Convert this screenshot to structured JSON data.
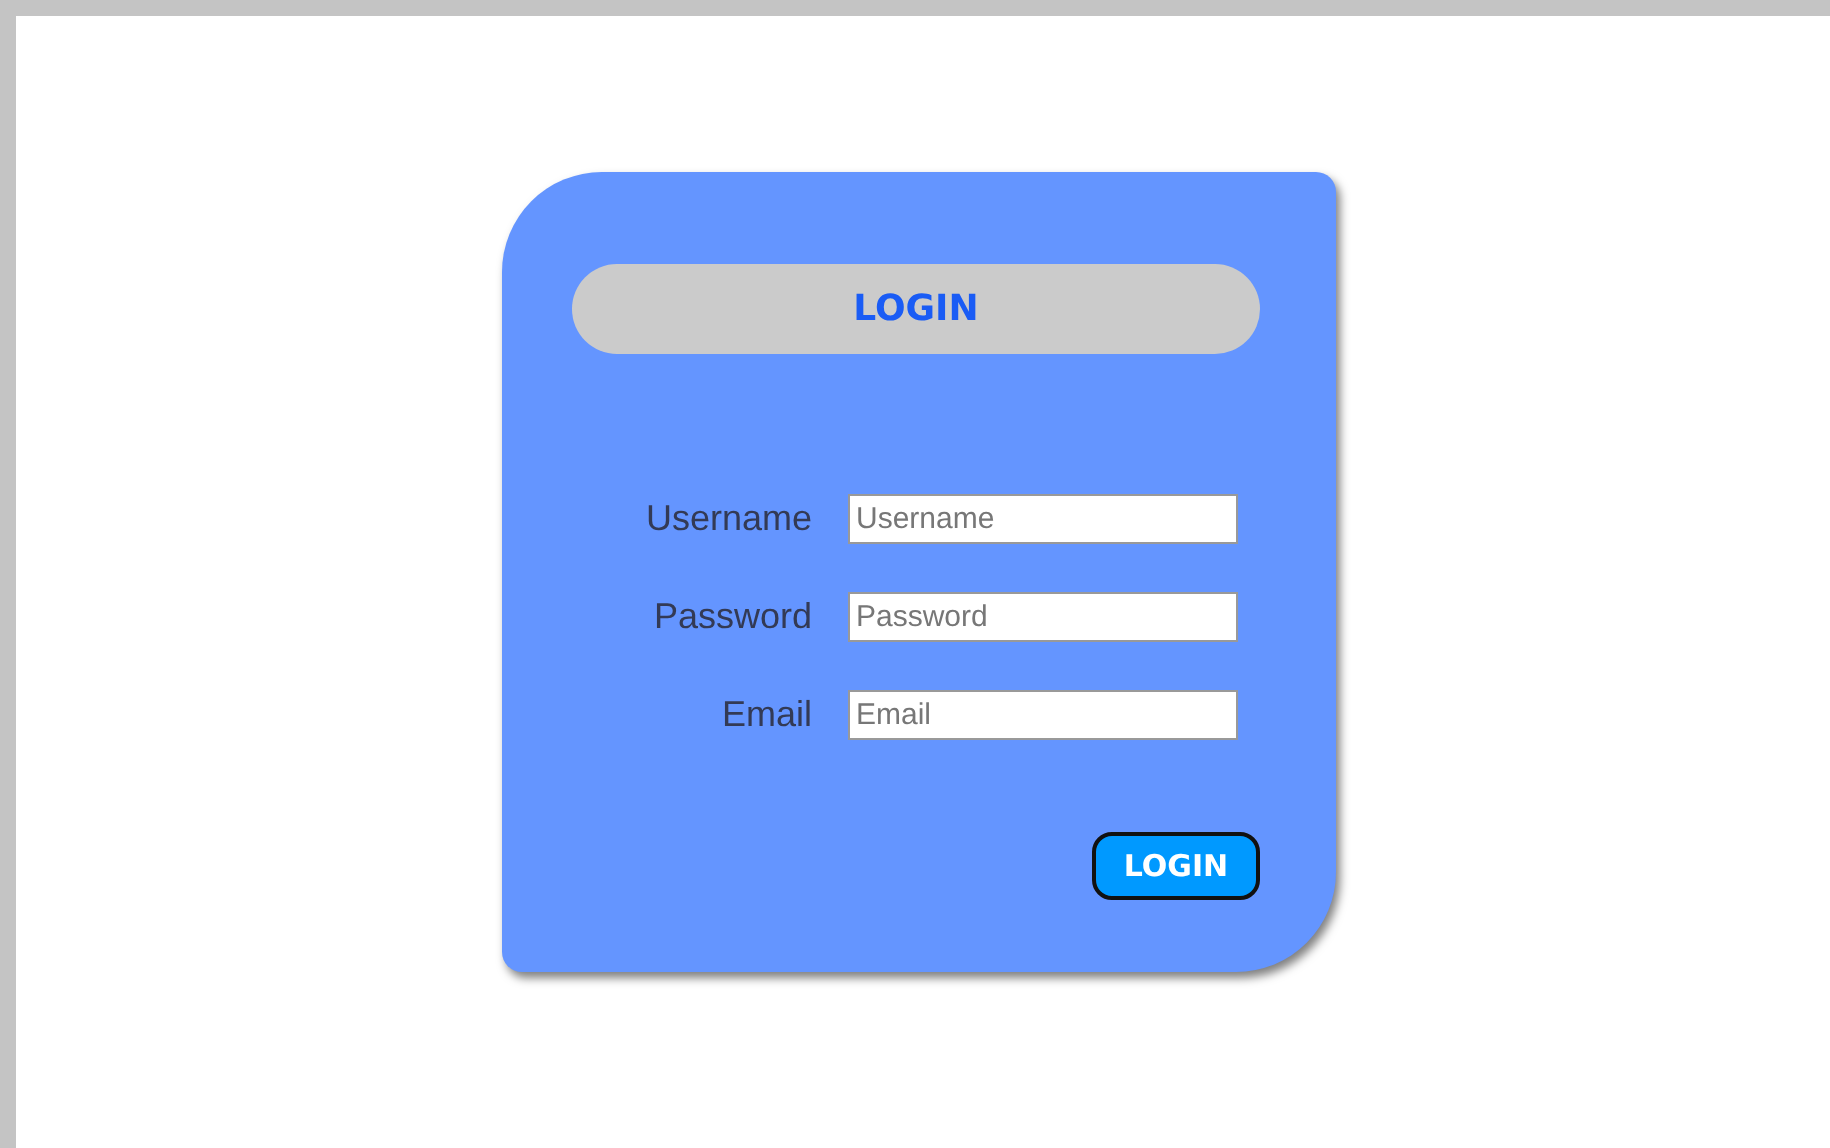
{
  "heading": "LOGIN",
  "fields": [
    {
      "label": "Username",
      "placeholder": "Username"
    },
    {
      "label": "Password",
      "placeholder": "Password"
    },
    {
      "label": "Email",
      "placeholder": "Email"
    }
  ],
  "button": "LOGIN"
}
